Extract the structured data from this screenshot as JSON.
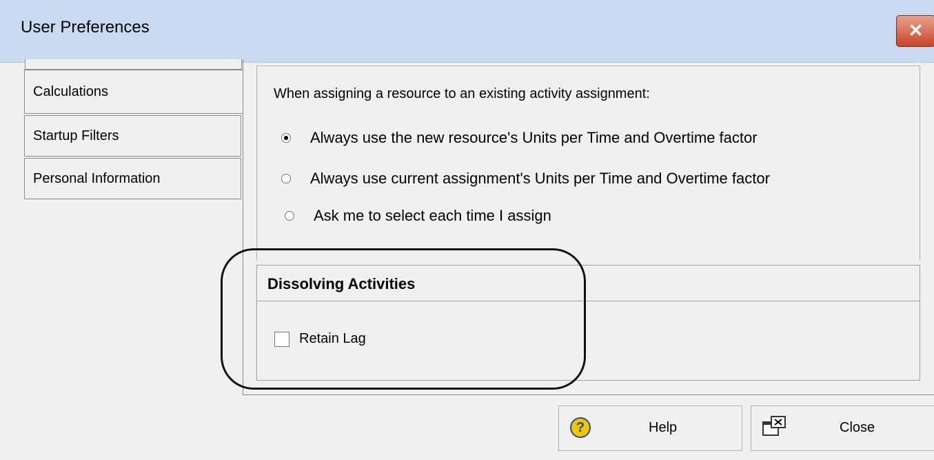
{
  "window": {
    "title": "User Preferences",
    "close_symbol": "✕"
  },
  "tabs": [
    {
      "label": "Calculations",
      "active": true
    },
    {
      "label": "Startup Filters",
      "active": false
    },
    {
      "label": "Personal Information",
      "active": false
    }
  ],
  "calc": {
    "prompt": "When assigning a resource to an existing activity assignment:",
    "options": [
      {
        "label": "Always use the new resource's Units per Time and Overtime factor",
        "selected": true
      },
      {
        "label": "Always use current assignment's Units per Time and Overtime factor",
        "selected": false
      },
      {
        "label": "Ask me to select each time I assign",
        "selected": false
      }
    ]
  },
  "dissolving": {
    "title": "Dissolving Activities",
    "retain_lag_label": "Retain Lag",
    "retain_lag_checked": false
  },
  "buttons": {
    "help": "Help",
    "close": "Close"
  },
  "colors": {
    "titlebar": "#c8daf0",
    "dialog_bg": "#f0f0f0",
    "close_button": "#c7452a"
  }
}
